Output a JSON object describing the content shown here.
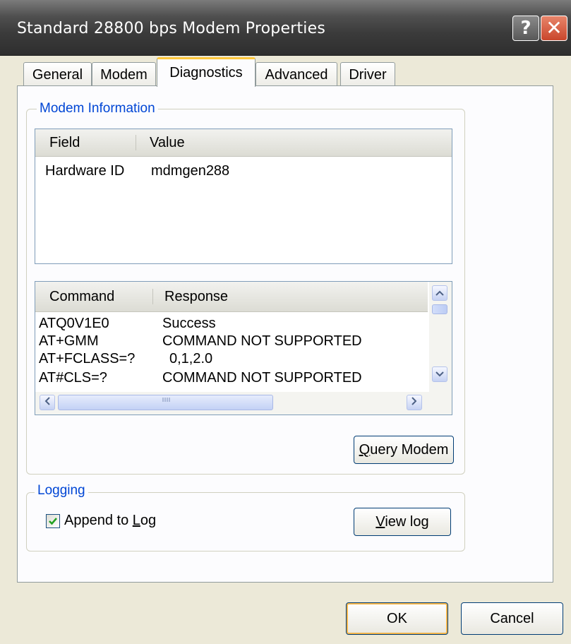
{
  "window": {
    "title": "Standard 28800 bps Modem Properties",
    "help_label": "?",
    "close_label": "✕"
  },
  "tabs": [
    {
      "label": "General"
    },
    {
      "label": "Modem"
    },
    {
      "label": "Diagnostics",
      "active": true
    },
    {
      "label": "Advanced"
    },
    {
      "label": "Driver"
    }
  ],
  "modem_info": {
    "group_title": "Modem Information",
    "info_list": {
      "columns": [
        "Field",
        "Value"
      ],
      "rows": [
        {
          "field": "Hardware ID",
          "value": "mdmgen288"
        }
      ]
    },
    "command_list": {
      "columns": [
        "Command",
        "Response"
      ],
      "rows": [
        {
          "command": "ATQ0V1E0",
          "response": "Success"
        },
        {
          "command": "AT+GMM",
          "response": "COMMAND NOT SUPPORTED"
        },
        {
          "command": "AT+FCLASS=?",
          "response": "0,1,2.0"
        },
        {
          "command": "AT#CLS=?",
          "response": "COMMAND NOT SUPPORTED"
        }
      ]
    },
    "query_button": {
      "mnemonic": "Q",
      "rest": "uery Modem"
    }
  },
  "logging": {
    "group_title": "Logging",
    "append_checkbox": {
      "checked": true,
      "label_before": "Append to ",
      "mnemonic": "L",
      "label_after": "og"
    },
    "view_log_button": {
      "mnemonic": "V",
      "rest": "iew log"
    }
  },
  "footer": {
    "ok_label": "OK",
    "cancel_label": "Cancel"
  },
  "colors": {
    "accent_blue": "#0046d5",
    "active_tab_highlight": "#ffc83c",
    "close_button": "#c9462c"
  }
}
